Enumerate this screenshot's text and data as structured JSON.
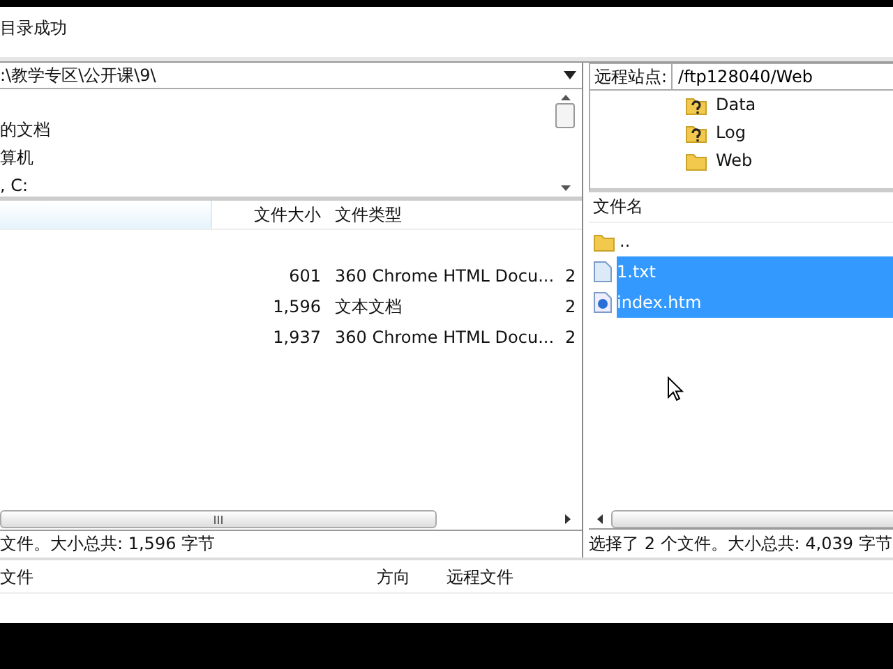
{
  "log": {
    "lines": [
      "目录成功"
    ]
  },
  "local": {
    "path": ":\\教学专区\\公开课\\9\\",
    "tree": [
      "的文档",
      "算机",
      ", C:"
    ],
    "columns": {
      "size": "文件大小",
      "type": "文件类型"
    },
    "rows": [
      {
        "size": "601",
        "type": "360 Chrome HTML Docu...",
        "column_4": "2"
      },
      {
        "size": "1,596",
        "type": "文本文档",
        "column_4": "2"
      },
      {
        "size": "1,937",
        "type": "360 Chrome HTML Docu...",
        "column_4": "2"
      }
    ],
    "status": "文件。大小总共: 1,596 字节"
  },
  "remote": {
    "label": "远程站点:",
    "path": "/ftp128040/Web",
    "tree": [
      {
        "name": "Data",
        "kind": "unknown"
      },
      {
        "name": "Log",
        "kind": "unknown"
      },
      {
        "name": "Web",
        "kind": "folder"
      }
    ],
    "columns": [
      "文件名"
    ],
    "rows": [
      {
        "name": "..",
        "kind": "folder",
        "selected": false
      },
      {
        "name": "1.txt",
        "kind": "text",
        "selected": true
      },
      {
        "name": "index.htm",
        "kind": "web",
        "selected": true
      }
    ],
    "status": "选择了 2 个文件。大小总共: 4,039 字节"
  },
  "queue": {
    "columns": {
      "local": "文件",
      "direction": "方向",
      "remote": "远程文件"
    }
  }
}
